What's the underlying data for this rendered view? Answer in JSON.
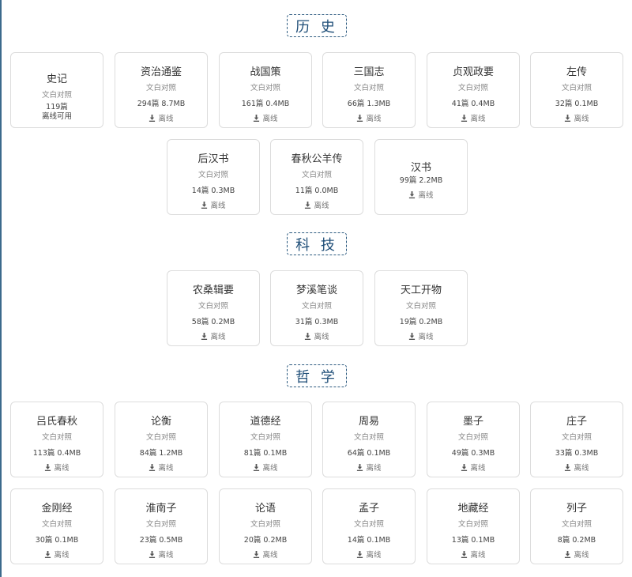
{
  "colors": {
    "accent": "#1f4e78",
    "border": "#dcdcdc"
  },
  "sections": [
    {
      "title": "历 史"
    },
    {
      "title": "科 技"
    },
    {
      "title": "哲 学"
    }
  ],
  "common": {
    "subtitle": "文白对照",
    "offline": "离线",
    "download_icon": "download-icon"
  },
  "history": [
    {
      "name": "史记",
      "stats": "119篇",
      "status": "离线可用"
    },
    {
      "name": "资治通鉴",
      "stats": "294篇 8.7MB"
    },
    {
      "name": "战国策",
      "stats": "161篇 0.4MB"
    },
    {
      "name": "三国志",
      "stats": "66篇 1.3MB"
    },
    {
      "name": "贞观政要",
      "stats": "41篇 0.4MB"
    },
    {
      "name": "左传",
      "stats": "32篇 0.1MB"
    },
    {
      "name": "后汉书",
      "stats": "14篇 0.3MB"
    },
    {
      "name": "春秋公羊传",
      "stats": "11篇 0.0MB"
    },
    {
      "name": "汉书",
      "stats": "99篇 2.2MB"
    }
  ],
  "tech": [
    {
      "name": "农桑辑要",
      "stats": "58篇 0.2MB"
    },
    {
      "name": "梦溪笔谈",
      "stats": "31篇 0.3MB"
    },
    {
      "name": "天工开物",
      "stats": "19篇 0.2MB"
    }
  ],
  "philosophy": [
    {
      "name": "吕氏春秋",
      "stats": "113篇 0.4MB"
    },
    {
      "name": "论衡",
      "stats": "84篇 1.2MB"
    },
    {
      "name": "道德经",
      "stats": "81篇 0.1MB"
    },
    {
      "name": "周易",
      "stats": "64篇 0.1MB"
    },
    {
      "name": "墨子",
      "stats": "49篇 0.3MB"
    },
    {
      "name": "庄子",
      "stats": "33篇 0.3MB"
    },
    {
      "name": "金刚经",
      "stats": "30篇 0.1MB"
    },
    {
      "name": "淮南子",
      "stats": "23篇 0.5MB"
    },
    {
      "name": "论语",
      "stats": "20篇 0.2MB"
    },
    {
      "name": "孟子",
      "stats": "14篇 0.1MB"
    },
    {
      "name": "地藏经",
      "stats": "13篇 0.1MB"
    },
    {
      "name": "列子",
      "stats": "8篇 0.2MB"
    }
  ]
}
